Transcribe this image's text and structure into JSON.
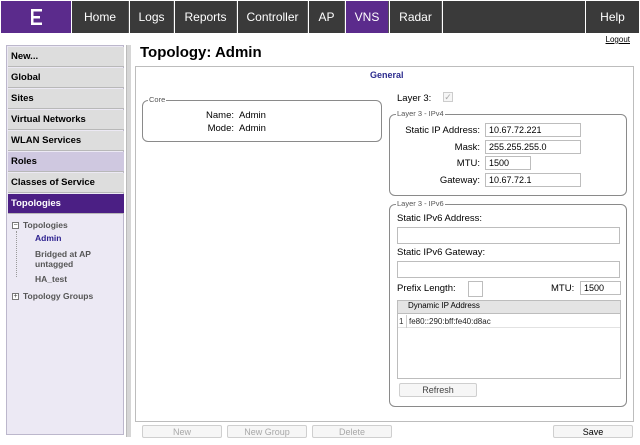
{
  "nav": {
    "logo_icon": "extreme-logo-icon",
    "items": [
      "Home",
      "Logs",
      "Reports",
      "Controller",
      "AP",
      "VNS",
      "Radar"
    ],
    "active": "VNS",
    "help": "Help",
    "logout": "Logout"
  },
  "sidebar": {
    "items": [
      "New...",
      "Global",
      "Sites",
      "Virtual Networks",
      "WLAN Services",
      "Roles",
      "Classes of Service",
      "Topologies"
    ],
    "active": "Topologies",
    "tree": {
      "topologies_label": "Topologies",
      "children": [
        "Admin",
        "Bridged at AP",
        "untagged",
        "HA_test"
      ],
      "selected": "Admin",
      "groups_label": "Topology Groups"
    }
  },
  "main": {
    "title": "Topology: Admin",
    "section": "General",
    "core": {
      "legend": "Core",
      "name_label": "Name:",
      "name_value": "Admin",
      "mode_label": "Mode:",
      "mode_value": "Admin"
    },
    "layer3": {
      "label": "Layer 3:",
      "checked": true
    },
    "ipv4": {
      "legend": "Layer 3 - IPv4",
      "static_ip_label": "Static IP Address:",
      "static_ip": "10.67.72.221",
      "mask_label": "Mask:",
      "mask": "255.255.255.0",
      "mtu_label": "MTU:",
      "mtu": "1500",
      "gateway_label": "Gateway:",
      "gateway": "10.67.72.1"
    },
    "ipv6": {
      "legend": "Layer 3 - IPv6",
      "static_addr_label": "Static IPv6 Address:",
      "static_addr": "",
      "static_gw_label": "Static IPv6 Gateway:",
      "static_gw": "",
      "prefix_label": "Prefix Length:",
      "prefix": "",
      "mtu_label": "MTU:",
      "mtu": "1500",
      "table_header": "Dynamic IP Address",
      "rows": [
        {
          "index": "1",
          "address": "fe80::290:bff:fe40:d8ac"
        }
      ],
      "refresh": "Refresh"
    }
  },
  "footer": {
    "new": "New",
    "new_group": "New Group",
    "delete": "Delete",
    "save": "Save"
  },
  "colors": {
    "brand": "#5b2b8c",
    "nav_bg": "#3a3a3a",
    "sidebar_active": "#4b1f84",
    "link": "#2b1f8e"
  }
}
